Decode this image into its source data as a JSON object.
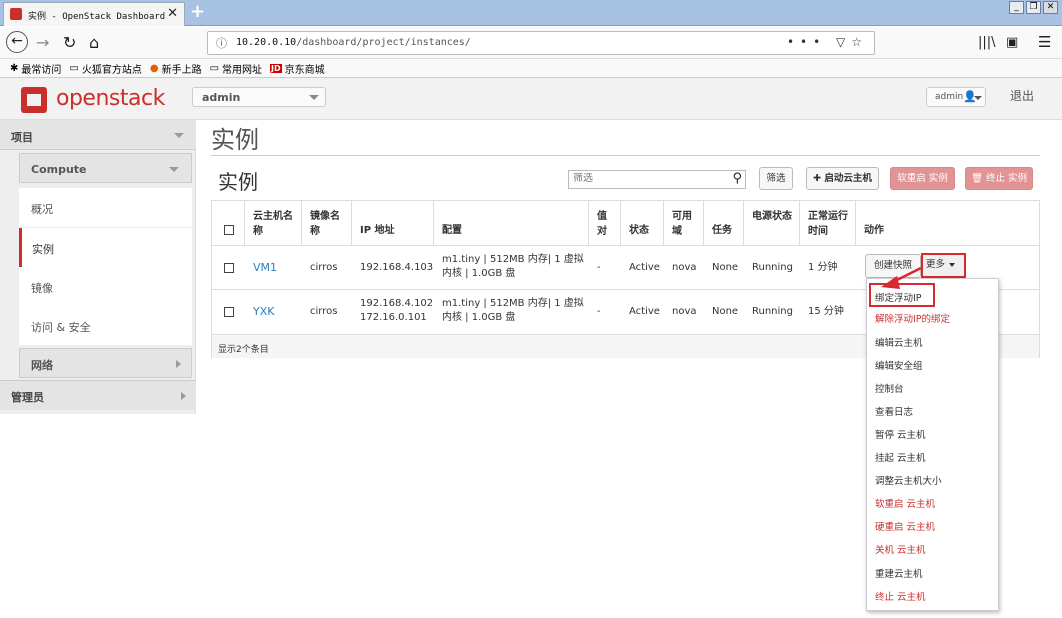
{
  "browser": {
    "tab_title": "实例 - OpenStack Dashboard",
    "tab_close": "✕",
    "new_tab": "+",
    "url_host": "10.20.0.10",
    "url_path": "/dashboard/project/instances/",
    "url_more": "•••",
    "bookmarks": [
      "最常访问",
      "火狐官方站点",
      "新手上路",
      "常用网址",
      "京东商城"
    ],
    "bookmark_jd": "JD"
  },
  "header": {
    "logo_text": "openstack",
    "project": "admin",
    "user": "admin",
    "logout": "退出"
  },
  "sidebar": {
    "project": "项目",
    "compute": "Compute",
    "items": [
      "概况",
      "实例",
      "镜像",
      "访问 & 安全"
    ],
    "network": "网络",
    "admin": "管理员"
  },
  "page": {
    "title": "实例",
    "section_title": "实例",
    "filter_placeholder": "筛选",
    "filter_button": "筛选",
    "launch_button": "启动云主机",
    "soft_reboot_button": "软重启 实例",
    "terminate_button": "终止 实例"
  },
  "table": {
    "headers": [
      "云主机名称",
      "镜像名称",
      "IP 地址",
      "配置",
      "值对",
      "状态",
      "可用域",
      "任务",
      "电源状态",
      "正常运行时间",
      "动作"
    ],
    "rows": [
      {
        "name": "VM1",
        "image": "cirros",
        "ip": [
          "192.168.4.103"
        ],
        "flavor": [
          "m1.tiny | 512MB 内存| 1 虚拟",
          "内核 | 1.0GB 盘"
        ],
        "keypair": "-",
        "status": "Active",
        "az": "nova",
        "task": "None",
        "power": "Running",
        "uptime": "1 分钟"
      },
      {
        "name": "YXK",
        "image": "cirros",
        "ip": [
          "192.168.4.102",
          "172.16.0.101"
        ],
        "flavor": [
          "m1.tiny | 512MB 内存| 1 虚拟",
          "内核 | 1.0GB 盘"
        ],
        "keypair": "-",
        "status": "Active",
        "az": "nova",
        "task": "None",
        "power": "Running",
        "uptime": "15 分钟"
      }
    ],
    "footer": "显示2个条目",
    "snapshot_button": "创建快照",
    "more_button": "更多"
  },
  "menu": {
    "items": [
      {
        "label": "绑定浮动IP",
        "danger": false
      },
      {
        "label": "解除浮动IP的绑定",
        "danger": true
      },
      {
        "label": "编辑云主机",
        "danger": false
      },
      {
        "label": "编辑安全组",
        "danger": false
      },
      {
        "label": "控制台",
        "danger": false
      },
      {
        "label": "查看日志",
        "danger": false
      },
      {
        "label": "暂停 云主机",
        "danger": false
      },
      {
        "label": "挂起 云主机",
        "danger": false
      },
      {
        "label": "调整云主机大小",
        "danger": false
      },
      {
        "label": "软重启 云主机",
        "danger": true
      },
      {
        "label": "硬重启 云主机",
        "danger": true
      },
      {
        "label": "关机 云主机",
        "danger": true
      },
      {
        "label": "重建云主机",
        "danger": false
      },
      {
        "label": "终止 云主机",
        "danger": true
      }
    ]
  },
  "colors": {
    "brand": "#c9302c",
    "link": "#2a7fbf",
    "highlight": "#d9282f",
    "danger_button": "#e29393"
  }
}
